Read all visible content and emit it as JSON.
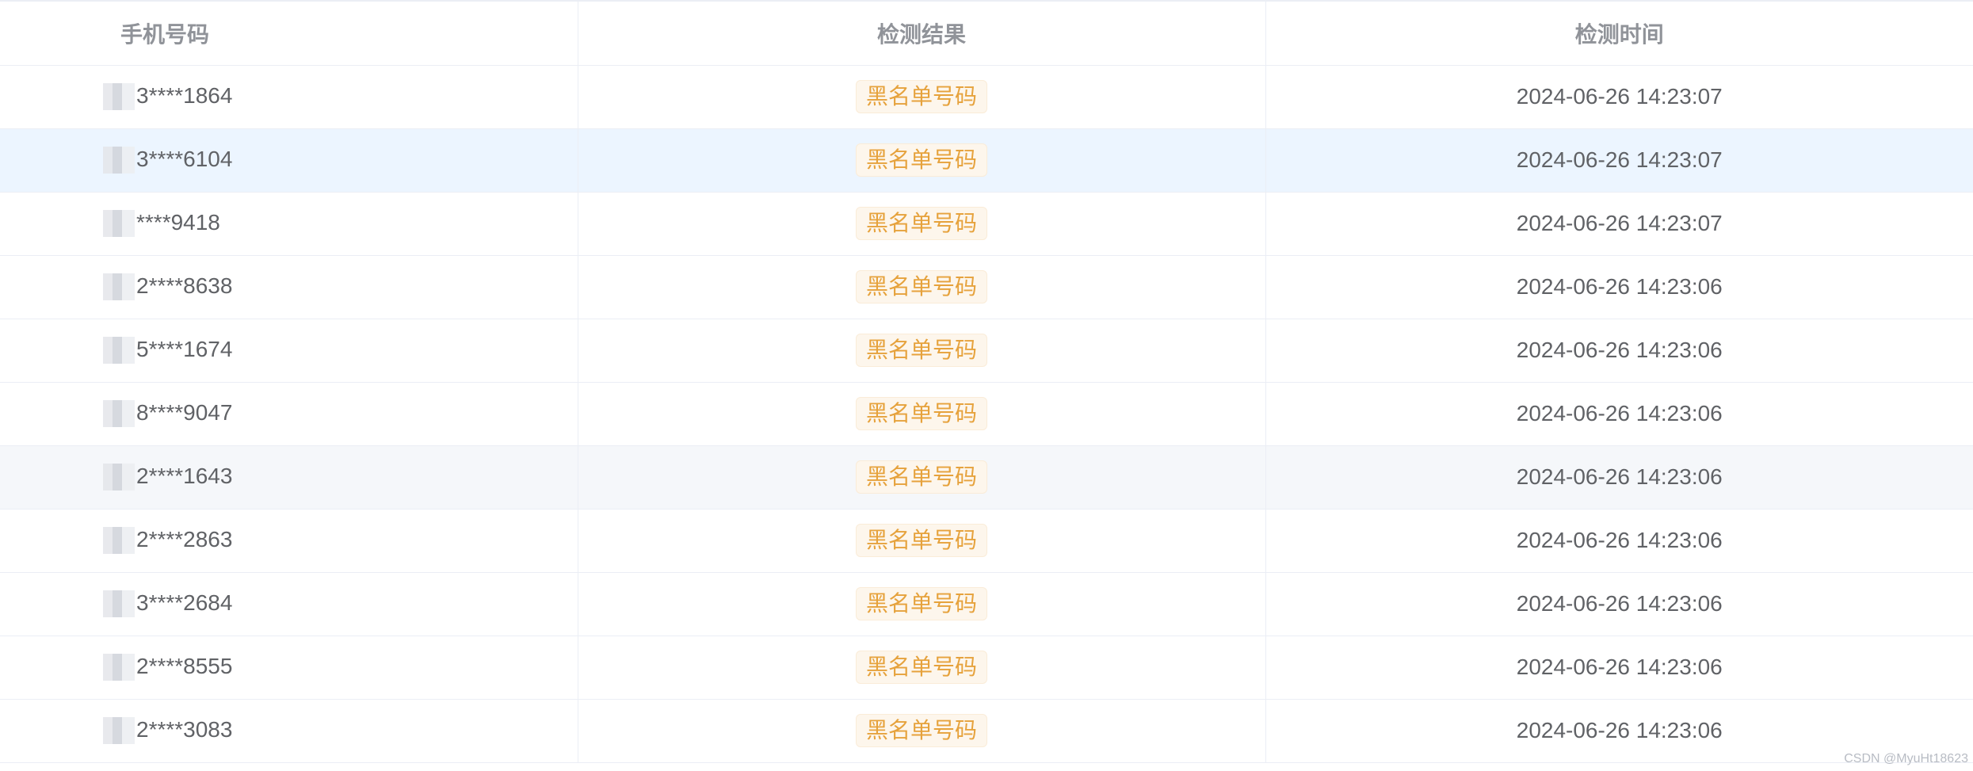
{
  "table": {
    "columns": {
      "phone": "手机号码",
      "result": "检测结果",
      "time": "检测时间"
    },
    "rows": [
      {
        "phone": "3****1864",
        "result": "黑名单号码",
        "time": "2024-06-26 14:23:07"
      },
      {
        "phone": "3****6104",
        "result": "黑名单号码",
        "time": "2024-06-26 14:23:07"
      },
      {
        "phone": "****9418",
        "result": "黑名单号码",
        "time": "2024-06-26 14:23:07"
      },
      {
        "phone": "2****8638",
        "result": "黑名单号码",
        "time": "2024-06-26 14:23:06"
      },
      {
        "phone": "5****1674",
        "result": "黑名单号码",
        "time": "2024-06-26 14:23:06"
      },
      {
        "phone": "8****9047",
        "result": "黑名单号码",
        "time": "2024-06-26 14:23:06"
      },
      {
        "phone": "2****1643",
        "result": "黑名单号码",
        "time": "2024-06-26 14:23:06"
      },
      {
        "phone": "2****2863",
        "result": "黑名单号码",
        "time": "2024-06-26 14:23:06"
      },
      {
        "phone": "3****2684",
        "result": "黑名单号码",
        "time": "2024-06-26 14:23:06"
      },
      {
        "phone": "2****8555",
        "result": "黑名单号码",
        "time": "2024-06-26 14:23:06"
      },
      {
        "phone": "2****3083",
        "result": "黑名单号码",
        "time": "2024-06-26 14:23:06"
      }
    ]
  },
  "watermark": "CSDN @MyuHt18623",
  "colors": {
    "header_text": "#909399",
    "cell_text": "#606266",
    "tag_text": "#e6a23c",
    "tag_bg": "#fdf6ec",
    "hover_row": "#ecf5ff",
    "striped_row": "#f5f7fa",
    "border": "#ebeef5"
  }
}
